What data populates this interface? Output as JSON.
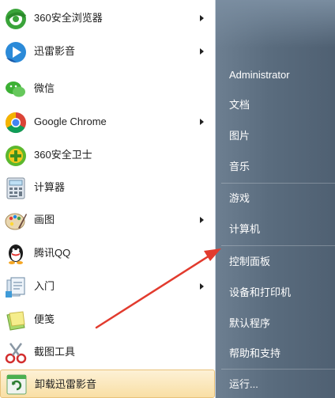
{
  "programs": [
    {
      "label": "360安全浏览器",
      "icon": "360-browser-icon",
      "submenu": true
    },
    {
      "label": "迅雷影音",
      "icon": "xunlei-player-icon",
      "submenu": true
    },
    {
      "label": "微信",
      "icon": "wechat-icon",
      "submenu": false
    },
    {
      "label": "Google Chrome",
      "icon": "chrome-icon",
      "submenu": true
    },
    {
      "label": "360安全卫士",
      "icon": "360-security-icon",
      "submenu": false
    },
    {
      "label": "计算器",
      "icon": "calculator-icon",
      "submenu": false
    },
    {
      "label": "画图",
      "icon": "paint-icon",
      "submenu": true
    },
    {
      "label": "腾讯QQ",
      "icon": "qq-icon",
      "submenu": false
    },
    {
      "label": "入门",
      "icon": "getting-started-icon",
      "submenu": true
    },
    {
      "label": "便笺",
      "icon": "sticky-notes-icon",
      "submenu": false
    },
    {
      "label": "截图工具",
      "icon": "snipping-tool-icon",
      "submenu": false
    },
    {
      "label": "卸载迅雷影音",
      "icon": "uninstall-icon",
      "submenu": false
    }
  ],
  "right_links": [
    "Administrator",
    "文档",
    "图片",
    "音乐",
    "游戏",
    "计算机",
    "控制面板",
    "设备和打印机",
    "默认程序",
    "帮助和支持",
    "运行..."
  ],
  "colors": {
    "highlight": "#f9dfa5",
    "arrow": "#e23b2e",
    "right_pane": "#5f7183"
  }
}
